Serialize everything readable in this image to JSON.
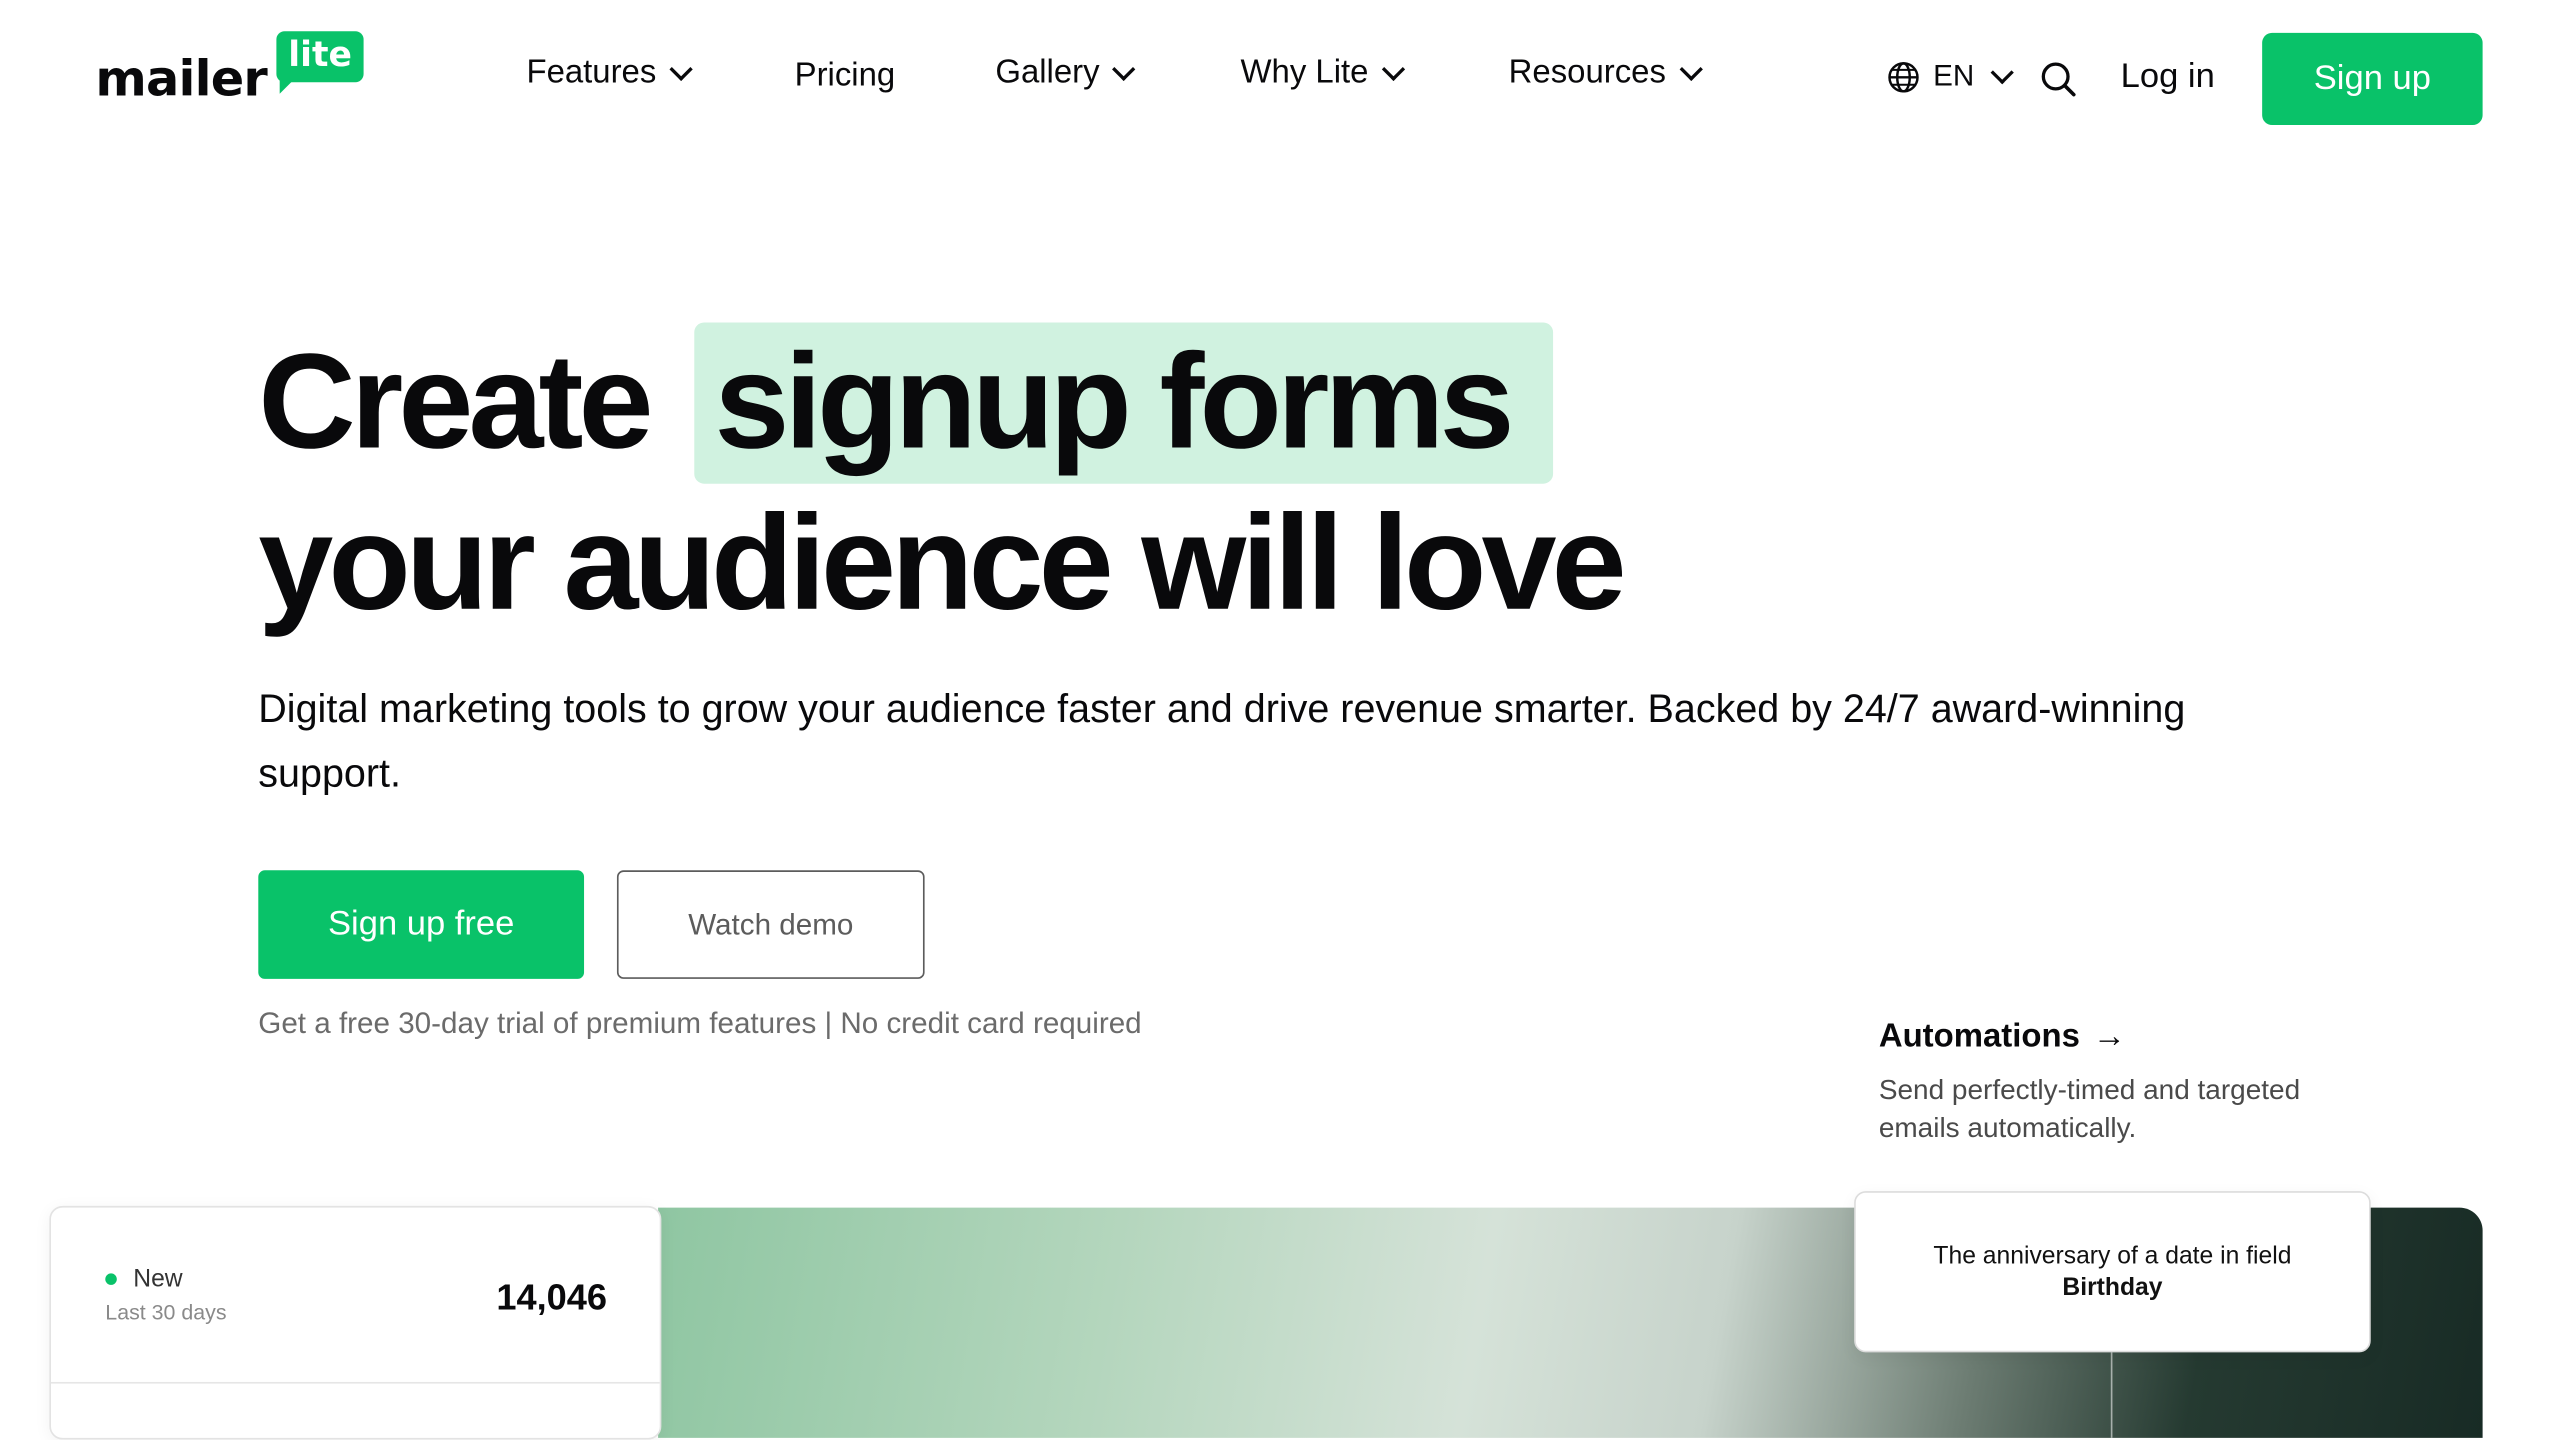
{
  "header": {
    "logo": {
      "word": "mailer",
      "badge": "lite"
    },
    "nav": [
      {
        "label": "Features",
        "has_dropdown": true
      },
      {
        "label": "Pricing",
        "has_dropdown": false
      },
      {
        "label": "Gallery",
        "has_dropdown": true
      },
      {
        "label": "Why Lite",
        "has_dropdown": true
      },
      {
        "label": "Resources",
        "has_dropdown": true
      }
    ],
    "language": "EN",
    "search_icon": "search-icon",
    "login_label": "Log in",
    "signup_label": "Sign up"
  },
  "hero": {
    "title_prefix": "Create",
    "title_highlight": "signup forms",
    "title_line2": "your audience will love",
    "subtitle": "Digital marketing tools to grow your audience faster and drive revenue smarter. Backed by 24/7 award-winning support.",
    "primary_cta": "Sign up free",
    "secondary_cta": "Watch demo",
    "trial_note": "Get a free 30-day trial of premium features | No credit card required"
  },
  "promo": {
    "title": "Automations",
    "arrow": "→",
    "description": "Send perfectly-timed and targeted emails automatically."
  },
  "stats_card": {
    "label": "New",
    "period": "Last 30 days",
    "value": "14,046"
  },
  "trigger_card": {
    "text": "The anniversary of a date in field ",
    "field": "Birthday"
  },
  "colors": {
    "brand_green": "#09c269",
    "highlight_bg": "#d0f2e0",
    "text_dark": "#09090b"
  }
}
